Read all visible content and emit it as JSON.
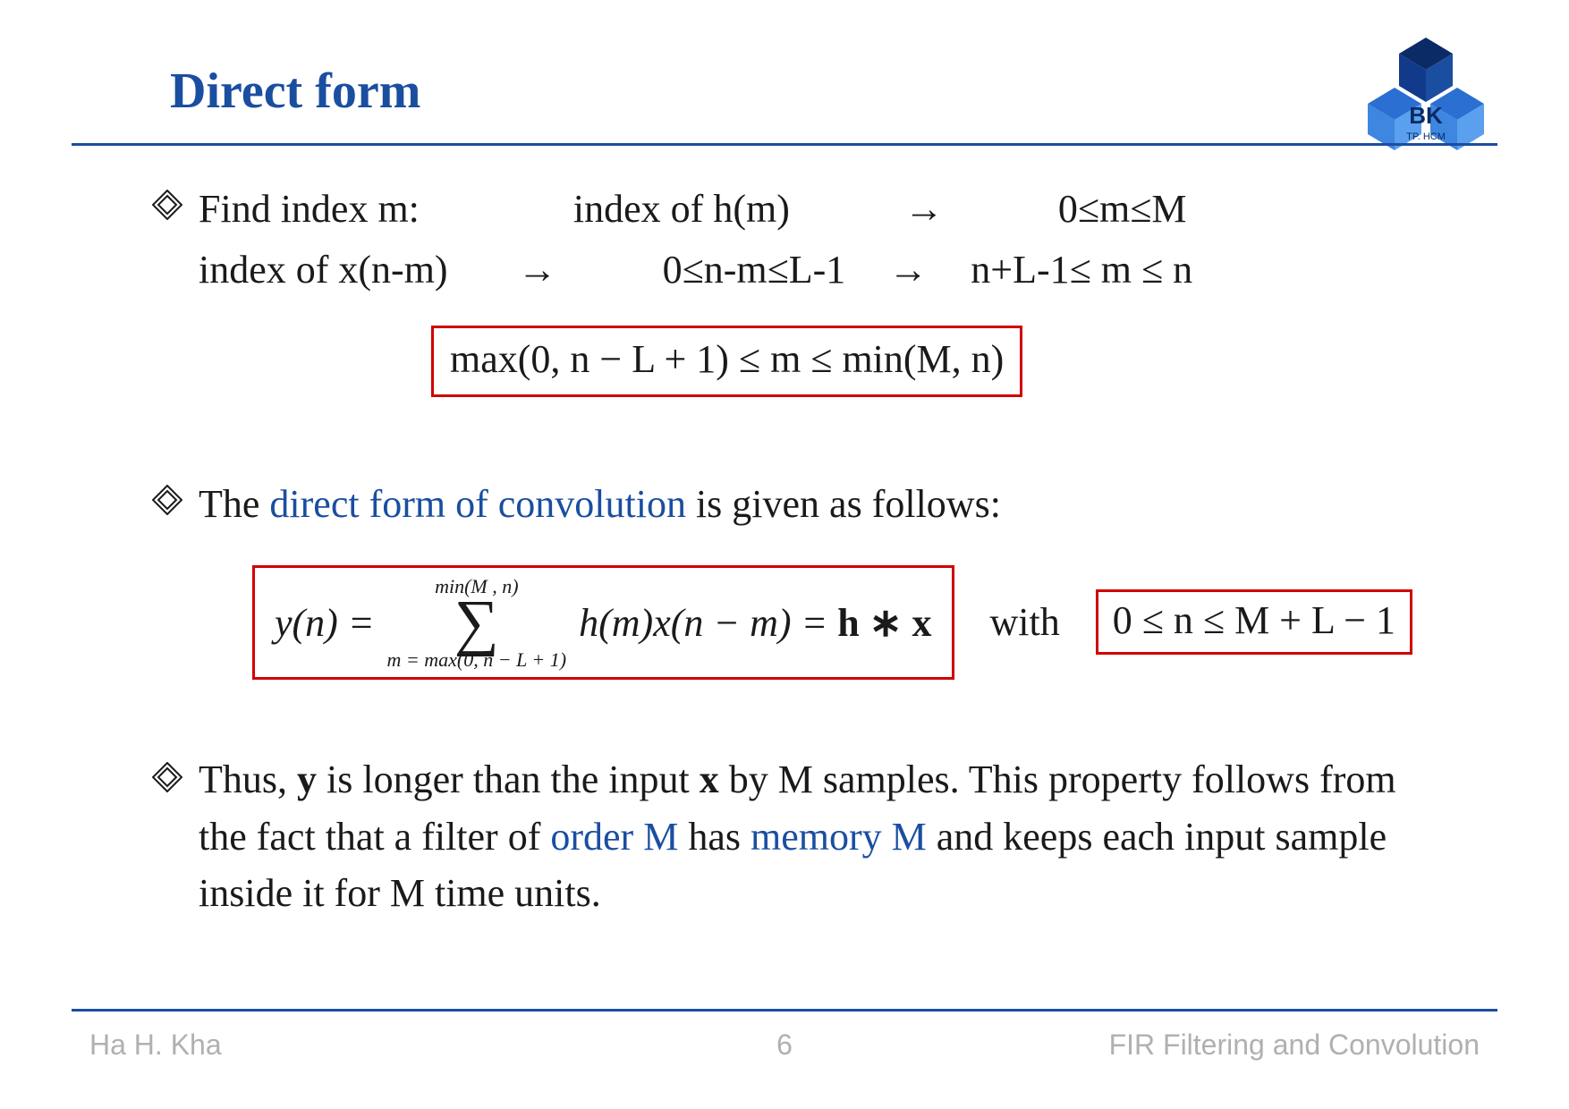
{
  "title": "Direct form",
  "logo": {
    "text_top": "BK",
    "text_bot": "TP. HCM"
  },
  "bullet1": {
    "line1": {
      "a": "Find index m:",
      "b": "index of h(m)",
      "arrow1": "→",
      "c": "0≤m≤M"
    },
    "line2": {
      "a": "index of x(n-m)",
      "arrow1": "→",
      "b": "0≤n-m≤L-1",
      "arrow2": "→",
      "c": "n+L-1≤ m ≤ n"
    },
    "box": "max(0, n − L + 1) ≤ m ≤ min(M, n)"
  },
  "bullet2": {
    "text_a": "The ",
    "text_b": "direct form of convolution",
    "text_c": " is given as follows:",
    "formula": {
      "lhs": "y(n) =",
      "sum_top": "min(M , n)",
      "sum_bot": "m = max(0, n − L + 1)",
      "rhs_a": "h(m)x(n − m) = ",
      "rhs_b": "h ∗ x"
    },
    "with": "with",
    "box2": "0  ≤ n ≤ M + L − 1"
  },
  "bullet3": {
    "s1": "Thus, ",
    "s2": "y",
    "s3": " is longer than the input ",
    "s4": "x",
    "s5": " by M samples. This property follows from the fact that a filter of ",
    "s6": "order M",
    "s7": " has ",
    "s8": "memory M",
    "s9": " and keeps each input sample inside it for M time units."
  },
  "footer": {
    "left": "Ha H. Kha",
    "page": "6",
    "right": "FIR Filtering and Convolution"
  }
}
